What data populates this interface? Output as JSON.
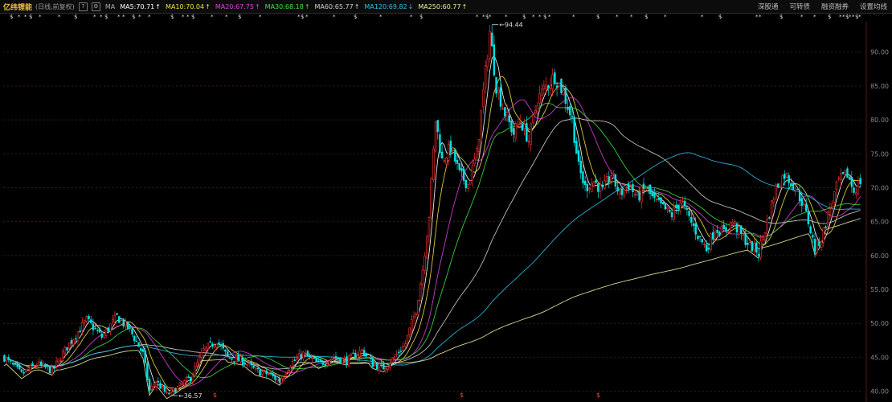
{
  "header": {
    "stock_name": "亿纬锂能",
    "period_label": "(日线,前复权)",
    "help_icon": "?",
    "settings_icon": "gear-icon",
    "ma_label": "MA",
    "ma": [
      {
        "label": "MA5:70.71",
        "color": "#ffffff",
        "trend": "↑"
      },
      {
        "label": "MA10:70.04",
        "color": "#f0e040",
        "trend": "↑"
      },
      {
        "label": "MA20:67.75",
        "color": "#e040e0",
        "trend": "↑"
      },
      {
        "label": "MA30:68.18",
        "color": "#40e040",
        "trend": "↑"
      },
      {
        "label": "MA60:65.77",
        "color": "#d0d0d0",
        "trend": "↑"
      },
      {
        "label": "MA120:69.82",
        "color": "#30c0e0",
        "trend": "↓"
      },
      {
        "label": "MA250:60.77",
        "color": "#f0f0a0",
        "trend": "↑"
      }
    ],
    "links": [
      "深股通",
      "可转债",
      "融资融券",
      "设置均线"
    ]
  },
  "chart_data": {
    "type": "candlestick",
    "ylim": [
      39,
      94
    ],
    "y_ticks": [
      40.0,
      45.0,
      50.0,
      55.0,
      60.0,
      65.0,
      70.0,
      75.0,
      80.0,
      85.0,
      90.0
    ],
    "high_label": "94.44",
    "low_label": "36.57",
    "bottom_marks": [
      "$",
      "$",
      "$"
    ],
    "up_color": "#ff3232",
    "down_color": "#00e0e0",
    "close_path": [
      [
        0,
        45.0
      ],
      [
        8,
        42.5
      ],
      [
        15,
        44.0
      ],
      [
        22,
        43.0
      ],
      [
        30,
        47.0
      ],
      [
        38,
        50.5
      ],
      [
        45,
        48.0
      ],
      [
        52,
        51.0
      ],
      [
        58,
        49.0
      ],
      [
        64,
        45.5
      ],
      [
        67,
        40.0
      ],
      [
        70,
        41.5
      ],
      [
        75,
        39.5
      ],
      [
        80,
        40.5
      ],
      [
        86,
        42.0
      ],
      [
        92,
        46.0
      ],
      [
        98,
        47.5
      ],
      [
        103,
        45.0
      ],
      [
        110,
        44.5
      ],
      [
        116,
        43.0
      ],
      [
        122,
        42.5
      ],
      [
        127,
        41.5
      ],
      [
        132,
        44.0
      ],
      [
        138,
        45.5
      ],
      [
        145,
        44.0
      ],
      [
        152,
        45.0
      ],
      [
        158,
        44.5
      ],
      [
        165,
        46.0
      ],
      [
        170,
        44.0
      ],
      [
        175,
        43.5
      ],
      [
        180,
        45.0
      ],
      [
        185,
        47.0
      ],
      [
        190,
        52.0
      ],
      [
        193,
        58.0
      ],
      [
        196,
        66.0
      ],
      [
        199,
        80.0
      ],
      [
        202,
        74.0
      ],
      [
        206,
        76.0
      ],
      [
        210,
        72.0
      ],
      [
        214,
        70.5
      ],
      [
        218,
        75.0
      ],
      [
        221,
        84.0
      ],
      [
        224,
        93.0
      ],
      [
        227,
        85.0
      ],
      [
        231,
        81.0
      ],
      [
        235,
        78.0
      ],
      [
        238,
        80.0
      ],
      [
        242,
        77.0
      ],
      [
        246,
        83.0
      ],
      [
        250,
        85.0
      ],
      [
        254,
        86.5
      ],
      [
        258,
        84.0
      ],
      [
        262,
        80.0
      ],
      [
        265,
        73.0
      ],
      [
        268,
        70.0
      ],
      [
        272,
        71.0
      ],
      [
        276,
        69.5
      ],
      [
        280,
        72.0
      ],
      [
        284,
        69.0
      ],
      [
        288,
        70.5
      ],
      [
        292,
        68.5
      ],
      [
        296,
        70.0
      ],
      [
        300,
        68.0
      ],
      [
        304,
        67.0
      ],
      [
        308,
        66.0
      ],
      [
        312,
        68.0
      ],
      [
        316,
        65.5
      ],
      [
        320,
        63.0
      ],
      [
        324,
        61.0
      ],
      [
        328,
        64.0
      ],
      [
        332,
        63.5
      ],
      [
        336,
        65.0
      ],
      [
        340,
        63.0
      ],
      [
        344,
        61.5
      ],
      [
        348,
        60.5
      ],
      [
        352,
        65.0
      ],
      [
        356,
        70.0
      ],
      [
        360,
        72.0
      ],
      [
        364,
        70.5
      ],
      [
        368,
        68.0
      ],
      [
        371,
        65.0
      ],
      [
        374,
        61.0
      ],
      [
        377,
        62.5
      ],
      [
        381,
        67.0
      ],
      [
        385,
        71.0
      ],
      [
        389,
        72.0
      ],
      [
        392,
        69.5
      ],
      [
        395,
        71.0
      ]
    ],
    "n_bars": 396
  }
}
